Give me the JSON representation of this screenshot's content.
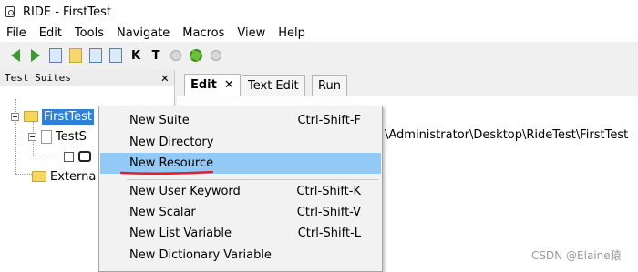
{
  "window": {
    "title": "RIDE - FirstTest"
  },
  "menubar": {
    "items": [
      "File",
      "Edit",
      "Tools",
      "Navigate",
      "Macros",
      "View",
      "Help"
    ]
  },
  "toolbar": {
    "icons": [
      "back-arrow-icon",
      "forward-arrow-icon",
      "open-directory-icon",
      "new-file-icon",
      "save-icon",
      "save-all-icon",
      "search-keywords-icon",
      "search-tests-icon",
      "run-icon",
      "debug-icon",
      "stop-icon"
    ],
    "search_keywords_label": "K",
    "search_tests_label": "T"
  },
  "left_panel": {
    "title": "Test Suites",
    "close_glyph": "✕",
    "tree": {
      "root": "FirstTest",
      "child_suite": "TestS",
      "external": "Externa"
    }
  },
  "tabs": [
    {
      "label": "Edit",
      "close_glyph": "✕"
    },
    {
      "label": "Text Edit"
    },
    {
      "label": "Run"
    }
  ],
  "main": {
    "source_path": "\\Administrator\\Desktop\\RideTest\\FirstTest"
  },
  "context_menu": {
    "group1": [
      {
        "label": "New Suite",
        "shortcut": "Ctrl-Shift-F"
      },
      {
        "label": "New Directory",
        "shortcut": ""
      },
      {
        "label": "New Resource",
        "shortcut": ""
      }
    ],
    "group2": [
      {
        "label": "New User Keyword",
        "shortcut": "Ctrl-Shift-K"
      },
      {
        "label": "New Scalar",
        "shortcut": "Ctrl-Shift-V"
      },
      {
        "label": "New List Variable",
        "shortcut": "Ctrl-Shift-L"
      },
      {
        "label": "New Dictionary Variable",
        "shortcut": ""
      }
    ],
    "highlight_color": "#91c9f7"
  },
  "annotation": {
    "underline_color": "#e0202a"
  },
  "watermark": "CSDN @Elaine猿"
}
